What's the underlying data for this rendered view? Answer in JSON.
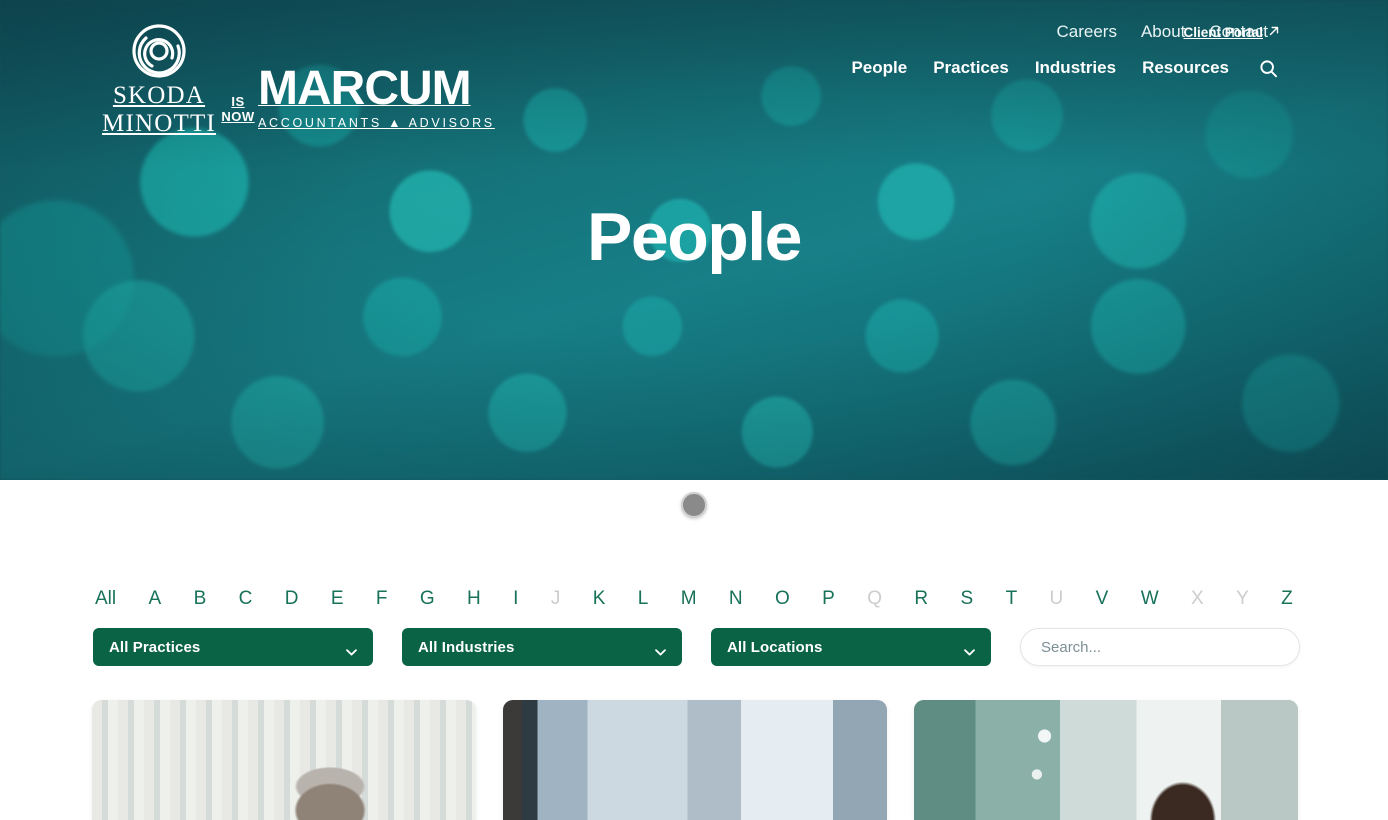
{
  "brand": {
    "mark_icon": "spiral-logo-icon",
    "skoda": "SKODA",
    "minotti": "MINOTTI",
    "is": "IS",
    "now": "NOW",
    "marcum": "MARCUM",
    "marcum_tagline": "ACCOUNTANTS ▲ ADVISORS"
  },
  "nav": {
    "top_links": [
      {
        "label": "Careers"
      },
      {
        "label": "About"
      },
      {
        "label": "Contact"
      }
    ],
    "client_portal": {
      "label": "Client Portal",
      "icon": "external-link-arrow-icon"
    },
    "main_links": [
      {
        "label": "People"
      },
      {
        "label": "Practices"
      },
      {
        "label": "Industries"
      },
      {
        "label": "Resources"
      }
    ],
    "search_icon": "search-icon"
  },
  "hero": {
    "title": "People"
  },
  "scroll_indicator": {
    "icon": "scroll-down-dot-icon"
  },
  "filters": {
    "alphabet": [
      {
        "label": "All",
        "enabled": true
      },
      {
        "label": "A",
        "enabled": true
      },
      {
        "label": "B",
        "enabled": true
      },
      {
        "label": "C",
        "enabled": true
      },
      {
        "label": "D",
        "enabled": true
      },
      {
        "label": "E",
        "enabled": true
      },
      {
        "label": "F",
        "enabled": true
      },
      {
        "label": "G",
        "enabled": true
      },
      {
        "label": "H",
        "enabled": true
      },
      {
        "label": "I",
        "enabled": true
      },
      {
        "label": "J",
        "enabled": false
      },
      {
        "label": "K",
        "enabled": true
      },
      {
        "label": "L",
        "enabled": true
      },
      {
        "label": "M",
        "enabled": true
      },
      {
        "label": "N",
        "enabled": true
      },
      {
        "label": "O",
        "enabled": true
      },
      {
        "label": "P",
        "enabled": true
      },
      {
        "label": "Q",
        "enabled": false
      },
      {
        "label": "R",
        "enabled": true
      },
      {
        "label": "S",
        "enabled": true
      },
      {
        "label": "T",
        "enabled": true
      },
      {
        "label": "U",
        "enabled": false
      },
      {
        "label": "V",
        "enabled": true
      },
      {
        "label": "W",
        "enabled": true
      },
      {
        "label": "X",
        "enabled": false
      },
      {
        "label": "Y",
        "enabled": false
      },
      {
        "label": "Z",
        "enabled": true
      }
    ],
    "practices": {
      "selected": "All Practices",
      "caret_icon": "chevron-down-icon"
    },
    "industries": {
      "selected": "All Industries",
      "caret_icon": "chevron-down-icon"
    },
    "locations": {
      "selected": "All Locations",
      "caret_icon": "chevron-down-icon"
    },
    "search": {
      "value": "",
      "placeholder": "Search..."
    }
  },
  "results": {
    "cards": [
      {
        "photo": "photo-a"
      },
      {
        "photo": "photo-b"
      },
      {
        "photo": "photo-c"
      }
    ]
  },
  "colors": {
    "brand_green": "#0b6346",
    "alpha_green": "#18725a",
    "alpha_disabled": "#cdcdcd",
    "hero_teal": "#1b5f68",
    "white": "#ffffff"
  }
}
